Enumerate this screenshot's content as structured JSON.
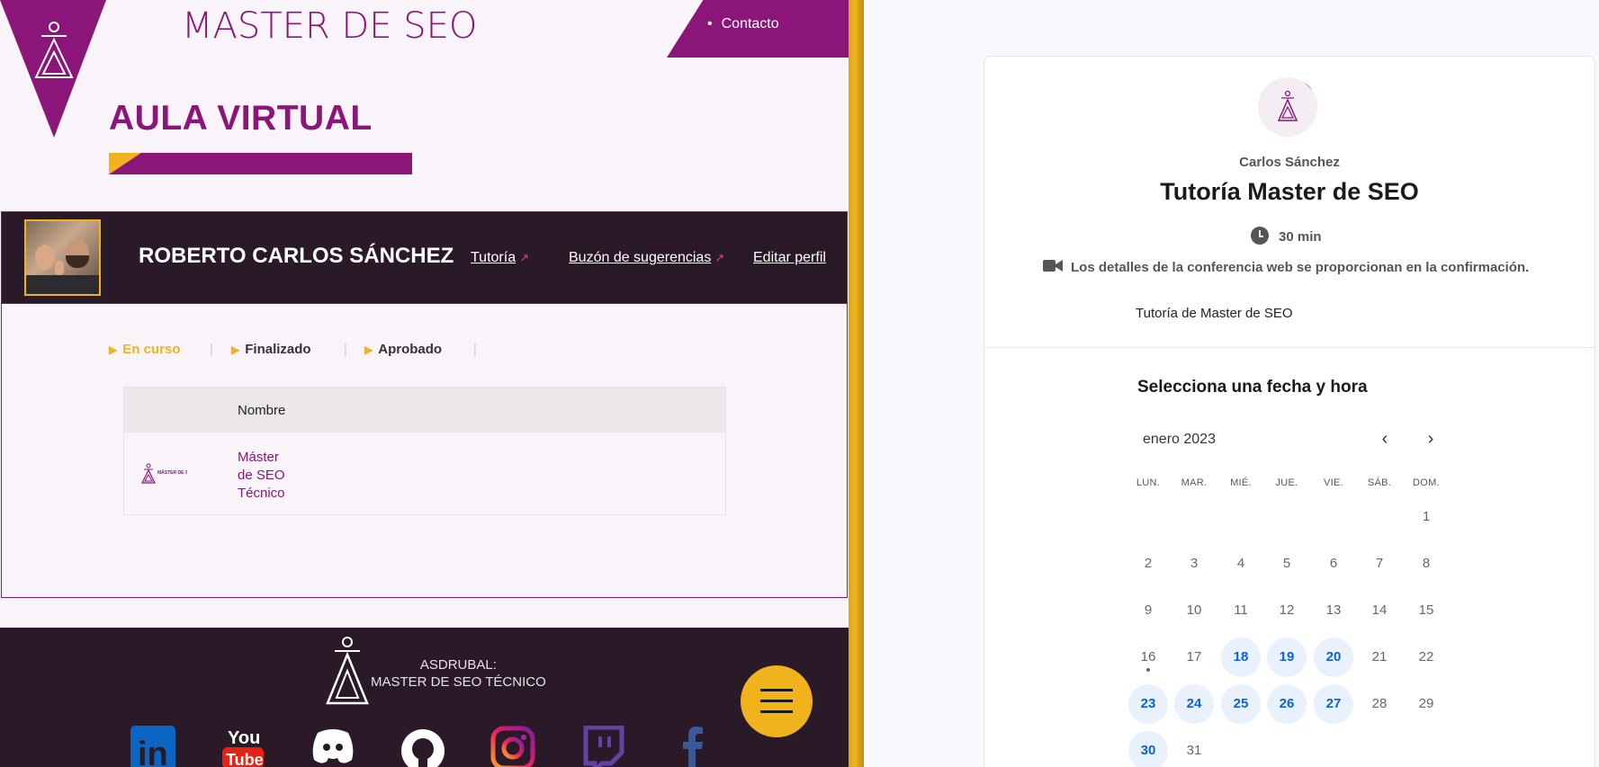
{
  "site": {
    "title": "MASTER DE SEO",
    "contact_link": "Contacto",
    "aula_title": "AULA VIRTUAL"
  },
  "profile": {
    "name": "ROBERTO CARLOS SÁNCHEZ",
    "links": [
      "Tutoría",
      "Buzón de sugerencias",
      "Editar perfil"
    ]
  },
  "tabs": [
    {
      "label": "En curso",
      "active": true
    },
    {
      "label": "Finalizado",
      "active": false
    },
    {
      "label": "Aprobado",
      "active": false
    }
  ],
  "course_table": {
    "header": "Nombre",
    "rows": [
      {
        "name_lines": [
          "Máster",
          "de SEO",
          "Técnico"
        ],
        "logo_text": "MÁSTER DE SEO TÉCNICO"
      }
    ]
  },
  "footer": {
    "line1": "ASDRUBAL:",
    "line2": "MASTER DE SEO TÉCNICO",
    "social_icons": [
      "linkedin-icon",
      "youtube-icon",
      "discord-icon",
      "github-icon",
      "instagram-icon",
      "twitch-icon",
      "facebook-icon"
    ],
    "youtube_text": [
      "You",
      "Tube"
    ],
    "linkedin_text": "in"
  },
  "booking": {
    "organizer": "Carlos Sánchez",
    "title": "Tutoría Master de SEO",
    "duration": "30 min",
    "conference_note": "Los detalles de la conferencia web se proporcionan en la confirmación.",
    "description": "Tutoría de Master de SEO",
    "select_heading": "Selecciona una fecha y hora",
    "month": "enero 2023",
    "weekdays": [
      "LUN.",
      "MAR.",
      "MIÉ.",
      "JUE.",
      "VIE.",
      "SÁB.",
      "DOM."
    ],
    "weeks": [
      [
        null,
        null,
        null,
        null,
        null,
        null,
        1
      ],
      [
        2,
        3,
        4,
        5,
        6,
        7,
        8
      ],
      [
        9,
        10,
        11,
        12,
        13,
        14,
        15
      ],
      [
        16,
        17,
        18,
        19,
        20,
        21,
        22
      ],
      [
        23,
        24,
        25,
        26,
        27,
        28,
        29
      ],
      [
        30,
        31,
        null,
        null,
        null,
        null,
        null
      ]
    ],
    "available_days": [
      18,
      19,
      20,
      23,
      24,
      25,
      26,
      27,
      30
    ],
    "today": 16
  },
  "colors": {
    "brand_purple": "#8b1579",
    "brand_yellow": "#f0b31e",
    "dark_band": "#2a1a28",
    "available_blue": "#0a62d6"
  }
}
